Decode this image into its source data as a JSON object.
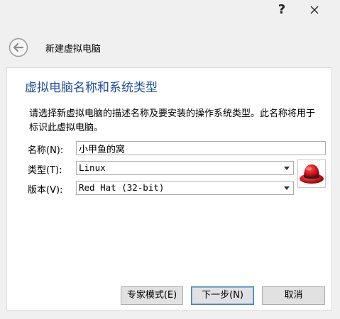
{
  "titlebar": {
    "help_label": "?",
    "close_label": "✕"
  },
  "header": {
    "title": "新建虚拟电脑",
    "back_icon": "back-arrow-icon"
  },
  "page": {
    "heading": "虚拟电脑名称和系统类型",
    "description": "请选择新虚拟电脑的描述名称及要安装的操作系统类型。此名称将用于标识此虚拟电脑。"
  },
  "form": {
    "name_label": "名称(N):",
    "name_value": "小甲鱼的窝",
    "type_label": "类型(T):",
    "type_value": "Linux",
    "version_label": "版本(V):",
    "version_value": "Red Hat (32-bit)",
    "os_icon": "red-hat-icon"
  },
  "buttons": {
    "expert_label": "专家模式(E)",
    "next_label": "下一步(N)",
    "cancel_label": "取消"
  },
  "colors": {
    "heading": "#1f4f9e",
    "red_hat": "#c8111c"
  }
}
